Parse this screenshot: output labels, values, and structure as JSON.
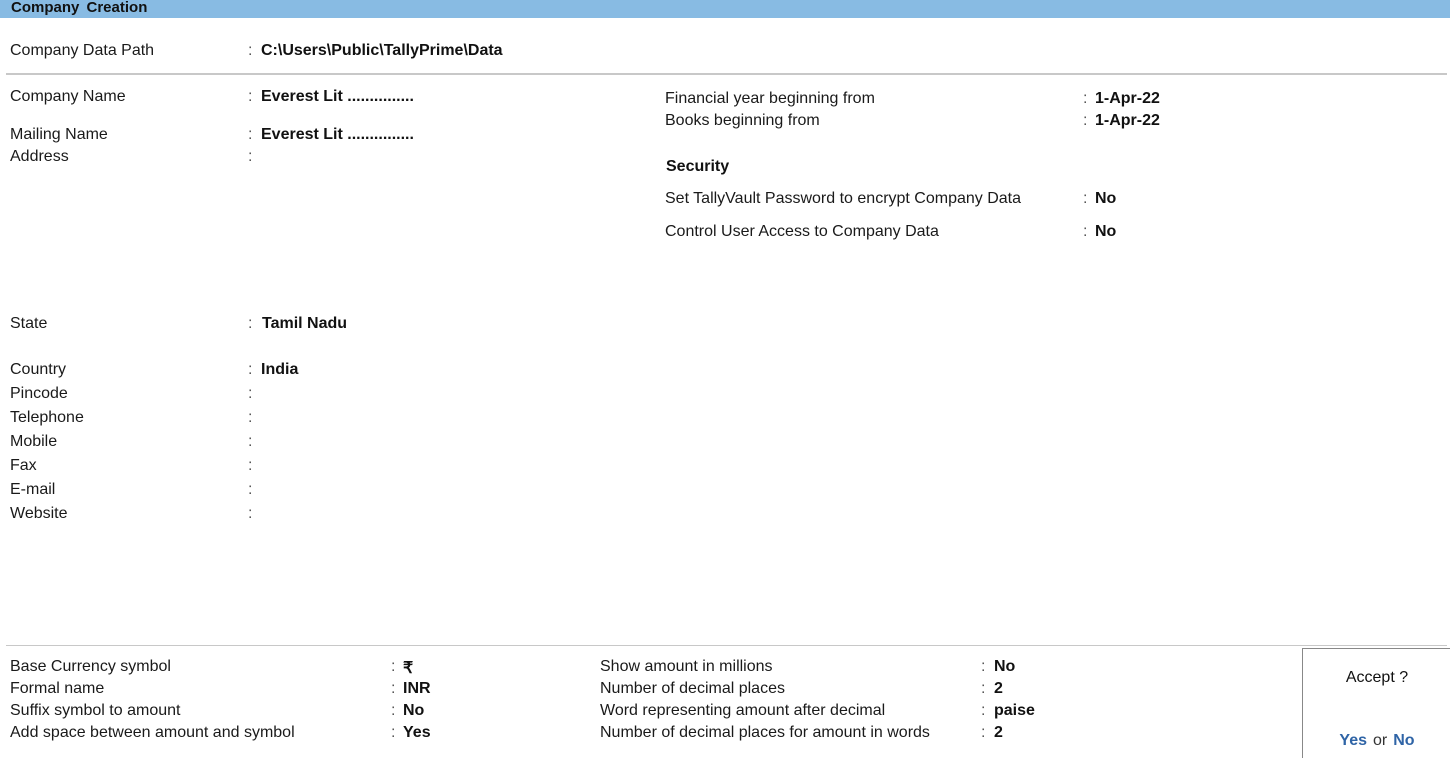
{
  "window": {
    "title": "Company Creation"
  },
  "data_path": {
    "label": "Company Data Path",
    "value": "C:\\Users\\Public\\TallyPrime\\Data"
  },
  "left_fields": {
    "company_name": {
      "label": "Company Name",
      "value": "Everest Lit ..............."
    },
    "mailing_name": {
      "label": "Mailing Name",
      "value": "Everest Lit ..............."
    },
    "address": {
      "label": "Address",
      "value": ""
    },
    "state": {
      "label": "State",
      "value": "Tamil Nadu"
    },
    "country": {
      "label": "Country",
      "value": "India"
    },
    "pincode": {
      "label": "Pincode",
      "value": ""
    },
    "telephone": {
      "label": "Telephone",
      "value": ""
    },
    "mobile": {
      "label": "Mobile",
      "value": ""
    },
    "fax": {
      "label": "Fax",
      "value": ""
    },
    "email": {
      "label": "E-mail",
      "value": ""
    },
    "website": {
      "label": "Website",
      "value": ""
    }
  },
  "right_fields": {
    "fy_begin": {
      "label": "Financial year beginning from",
      "value": "1-Apr-22"
    },
    "books_begin": {
      "label": "Books beginning from",
      "value": "1-Apr-22"
    },
    "security_heading": "Security",
    "tallyvault": {
      "label": "Set TallyVault Password to encrypt Company Data",
      "value": "No"
    },
    "user_access": {
      "label": "Control User Access to Company Data",
      "value": "No"
    }
  },
  "currency": {
    "left": [
      {
        "label": "Base Currency symbol",
        "value": "₹"
      },
      {
        "label": "Formal name",
        "value": "INR"
      },
      {
        "label": "Suffix symbol to amount",
        "value": "No"
      },
      {
        "label": "Add space between amount and symbol",
        "value": "Yes"
      }
    ],
    "right": [
      {
        "label": "Show amount in millions",
        "value": "No"
      },
      {
        "label": "Number of decimal places",
        "value": "2"
      },
      {
        "label": "Word representing amount after decimal",
        "value": "paise"
      },
      {
        "label": "Number of decimal places for amount in words",
        "value": "2"
      }
    ]
  },
  "accept_dialog": {
    "question": "Accept ?",
    "yes": "Yes",
    "or": "or",
    "no": "No"
  },
  "colors": {
    "titlebar": "#88bbe3",
    "accept_option": "#2f64a6"
  },
  "colon": ":"
}
